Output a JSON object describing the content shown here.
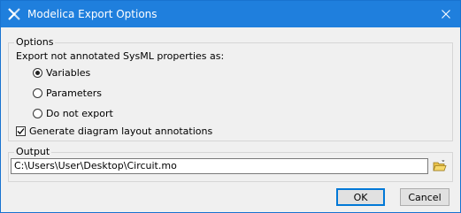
{
  "window": {
    "title": "Modelica Export Options",
    "icon": "modelica-app-icon",
    "close_icon": "close-icon",
    "titlebar_color": "#1f7fdd"
  },
  "options": {
    "group_label": "Options",
    "prompt": "Export not annotated SysML properties as:",
    "radios": [
      {
        "label": "Variables",
        "checked": true
      },
      {
        "label": "Parameters",
        "checked": false
      },
      {
        "label": "Do not export",
        "checked": false
      }
    ],
    "generate_layout": {
      "label": "Generate diagram layout annotations",
      "checked": true
    }
  },
  "output": {
    "group_label": "Output",
    "path": "C:\\Users\\User\\Desktop\\Circuit.mo",
    "browse_icon": "folder-open-icon"
  },
  "buttons": {
    "ok": "OK",
    "cancel": "Cancel"
  }
}
